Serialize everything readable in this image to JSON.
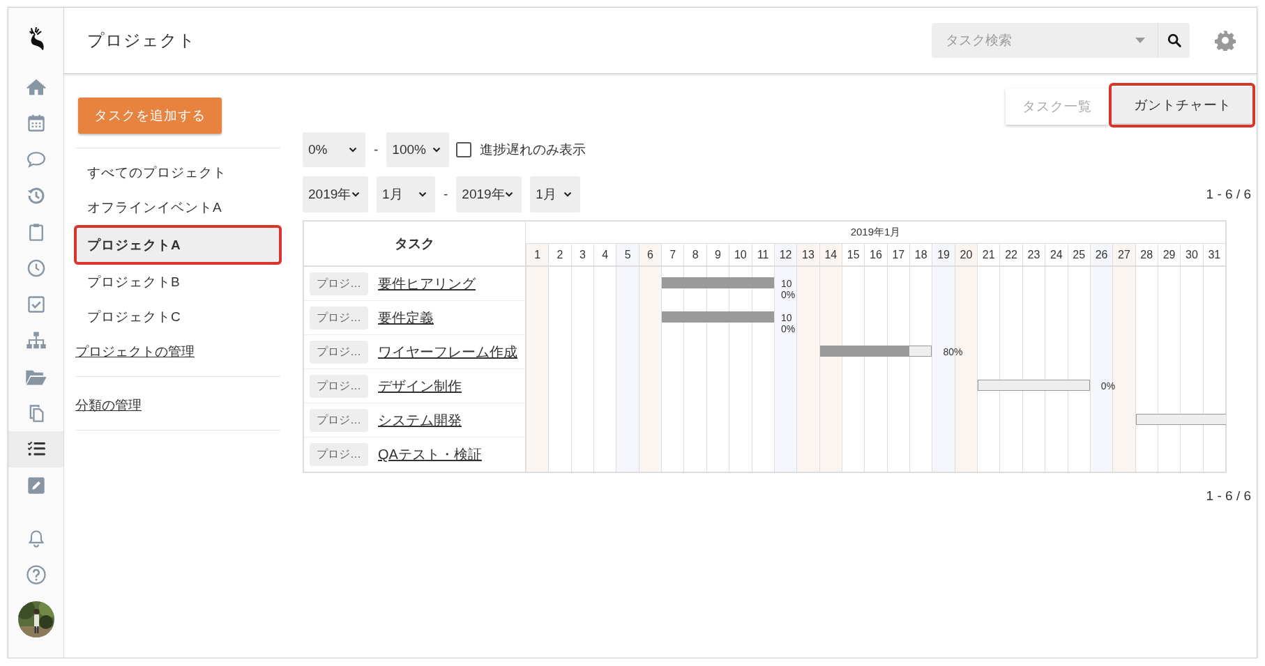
{
  "rail": {
    "items": [
      {
        "kind": "home",
        "selected": false
      },
      {
        "kind": "calendar",
        "selected": false
      },
      {
        "kind": "chat",
        "selected": false
      },
      {
        "kind": "history",
        "selected": false
      },
      {
        "kind": "clipboard",
        "selected": false
      },
      {
        "kind": "clock",
        "selected": false
      },
      {
        "kind": "checkbox",
        "selected": false
      },
      {
        "kind": "sitemap",
        "selected": false
      },
      {
        "kind": "folder",
        "selected": false
      },
      {
        "kind": "copy",
        "selected": false
      },
      {
        "kind": "tasks",
        "selected": true
      },
      {
        "kind": "edit",
        "selected": false
      }
    ],
    "bottom_items": [
      {
        "kind": "bell"
      },
      {
        "kind": "help"
      },
      {
        "kind": "avatar"
      }
    ]
  },
  "header": {
    "title": "プロジェクト",
    "search": {
      "placeholder": "タスク検索"
    }
  },
  "sidebar": {
    "add_button": "タスクを追加する",
    "projects": [
      {
        "label": "すべてのプロジェクト",
        "selected": false,
        "highlighted": false
      },
      {
        "label": "オフラインイベントA",
        "selected": false,
        "highlighted": false
      },
      {
        "label": "プロジェクトA",
        "selected": true,
        "highlighted": true
      },
      {
        "label": "プロジェクトB",
        "selected": false,
        "highlighted": false
      },
      {
        "label": "プロジェクトC",
        "selected": false,
        "highlighted": false
      }
    ],
    "links": [
      "プロジェクトの管理",
      "分類の管理"
    ]
  },
  "view_tabs": [
    {
      "label": "タスク一覧",
      "selected": false,
      "highlighted": false
    },
    {
      "label": "ガントチャート",
      "selected": true,
      "highlighted": true
    }
  ],
  "filters": {
    "progress_from": "0%",
    "progress_separator": "-",
    "progress_to": "100%",
    "delayed_only": {
      "label": "進捗遅れのみ表示",
      "checked": false
    },
    "from_year": "2019年",
    "from_month": "1月",
    "period_separator": "-",
    "to_year": "2019年",
    "to_month": "1月"
  },
  "pagination_top": "1 - 6 / 6",
  "gantt": {
    "task_header": "タスク",
    "month": "2019年1月",
    "days": [
      {
        "label": "1",
        "kind": "holiday"
      },
      {
        "label": "2",
        "kind": "weekday"
      },
      {
        "label": "3",
        "kind": "weekday"
      },
      {
        "label": "4",
        "kind": "weekday"
      },
      {
        "label": "5",
        "kind": "saturday"
      },
      {
        "label": "6",
        "kind": "holiday"
      },
      {
        "label": "7",
        "kind": "weekday"
      },
      {
        "label": "8",
        "kind": "weekday"
      },
      {
        "label": "9",
        "kind": "weekday"
      },
      {
        "label": "10",
        "kind": "weekday"
      },
      {
        "label": "11",
        "kind": "weekday"
      },
      {
        "label": "12",
        "kind": "saturday"
      },
      {
        "label": "13",
        "kind": "holiday"
      },
      {
        "label": "14",
        "kind": "holiday"
      },
      {
        "label": "15",
        "kind": "weekday"
      },
      {
        "label": "16",
        "kind": "weekday"
      },
      {
        "label": "17",
        "kind": "weekday"
      },
      {
        "label": "18",
        "kind": "weekday"
      },
      {
        "label": "19",
        "kind": "saturday"
      },
      {
        "label": "20",
        "kind": "holiday"
      },
      {
        "label": "21",
        "kind": "weekday"
      },
      {
        "label": "22",
        "kind": "weekday"
      },
      {
        "label": "23",
        "kind": "weekday"
      },
      {
        "label": "24",
        "kind": "weekday"
      },
      {
        "label": "25",
        "kind": "weekday"
      },
      {
        "label": "26",
        "kind": "saturday"
      },
      {
        "label": "27",
        "kind": "holiday"
      },
      {
        "label": "28",
        "kind": "weekday"
      },
      {
        "label": "29",
        "kind": "weekday"
      },
      {
        "label": "30",
        "kind": "weekday"
      },
      {
        "label": "31",
        "kind": "weekday"
      }
    ],
    "rows": [
      {
        "project": "プロジ…",
        "task": "要件ヒアリング",
        "level": 1,
        "progress": "100%",
        "bar_days": [
          false,
          false,
          false,
          false,
          false,
          false,
          true,
          true,
          true,
          true,
          true,
          false,
          false,
          false,
          false,
          false,
          false,
          false,
          false,
          false,
          false,
          false,
          false,
          false,
          false,
          false,
          false,
          false,
          false,
          false,
          false
        ]
      },
      {
        "project": "プロジ…",
        "task": "要件定義",
        "level": 1,
        "progress": "100%",
        "bar_days": [
          false,
          false,
          false,
          false,
          false,
          false,
          true,
          true,
          true,
          true,
          true,
          false,
          false,
          false,
          false,
          false,
          false,
          false,
          false,
          false,
          false,
          false,
          false,
          false,
          false,
          false,
          false,
          false,
          false,
          false,
          false
        ]
      },
      {
        "project": "プロジ…",
        "task": "ワイヤーフレーム作成",
        "level": 0.8,
        "progress": "80%",
        "bar_days": [
          false,
          false,
          false,
          false,
          false,
          false,
          false,
          false,
          false,
          false,
          false,
          false,
          false,
          true,
          true,
          true,
          true,
          true,
          false,
          false,
          false,
          false,
          false,
          false,
          false,
          false,
          false,
          false,
          false,
          false,
          false
        ]
      },
      {
        "project": "プロジ…",
        "task": "デザイン制作",
        "level": 0,
        "progress": "0%",
        "bar_days": [
          false,
          false,
          false,
          false,
          false,
          false,
          false,
          false,
          false,
          false,
          false,
          false,
          false,
          false,
          false,
          false,
          false,
          false,
          false,
          false,
          true,
          true,
          true,
          true,
          true,
          false,
          false,
          false,
          false,
          false,
          false
        ]
      },
      {
        "project": "プロジ…",
        "task": "システム開発",
        "continues": true,
        "level": 0,
        "bar_days": [
          false,
          false,
          false,
          false,
          false,
          false,
          false,
          false,
          false,
          false,
          false,
          false,
          false,
          false,
          false,
          false,
          false,
          false,
          false,
          false,
          false,
          false,
          false,
          false,
          false,
          false,
          false,
          true,
          true,
          true,
          true
        ]
      },
      {
        "project": "プロジ…",
        "task": "QAテスト・検証"
      }
    ]
  },
  "pagination_bottom": "1 - 6 / 6"
}
